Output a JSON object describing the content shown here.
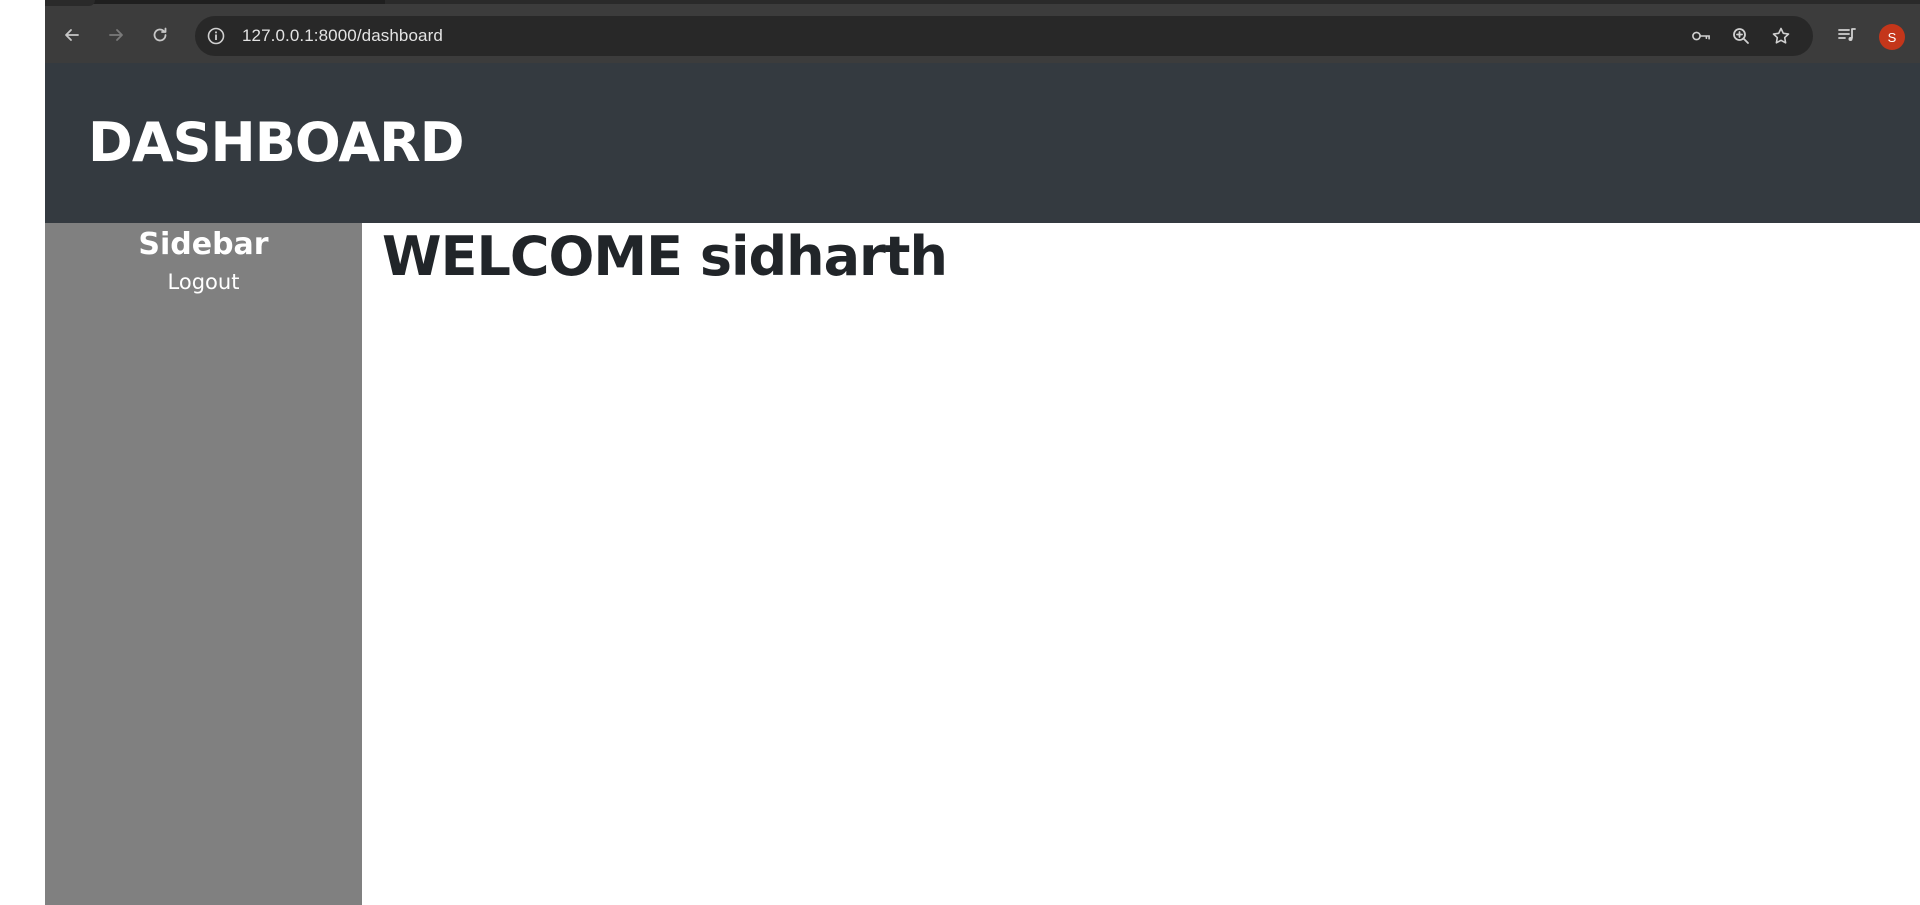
{
  "browser": {
    "url": "127.0.0.1:8000/dashboard",
    "icons": [
      "back-arrow-icon",
      "forward-arrow-icon",
      "reload-icon",
      "site-info-icon",
      "password-key-icon",
      "zoom-icon",
      "bookmark-star-icon",
      "media-queue-icon"
    ],
    "profile_initial": "S"
  },
  "header": {
    "title": "DASHBOARD"
  },
  "sidebar": {
    "title": "Sidebar",
    "logout_label": "Logout"
  },
  "main": {
    "welcome": "WELCOME sidharth"
  },
  "colors": {
    "header_bg": "#343a40",
    "sidebar_bg": "#808080",
    "avatar_bg": "#c4361a"
  }
}
